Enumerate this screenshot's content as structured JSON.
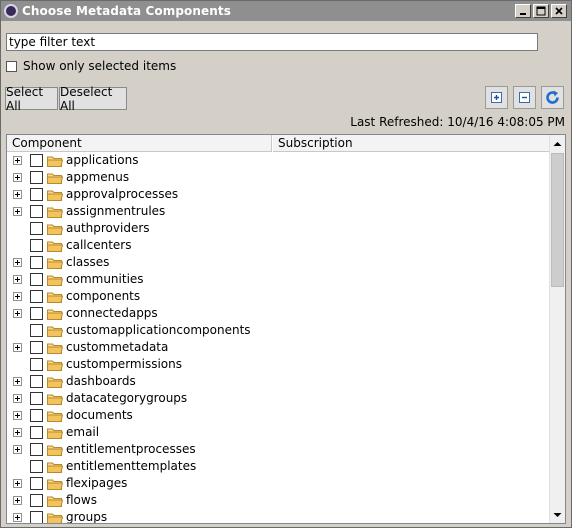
{
  "window": {
    "title": "Choose Metadata Components"
  },
  "filter": {
    "value": "type filter text"
  },
  "show_selected": {
    "label": "Show only selected items",
    "checked": false
  },
  "buttons": {
    "select_all": "Select All",
    "deselect_all": "Deselect All"
  },
  "icons": {
    "app": "app-icon",
    "minimize": "minimize-icon",
    "maximize": "maximize-icon",
    "close": "close-icon",
    "expand_all": "expand-all-icon",
    "collapse_all": "collapse-all-icon",
    "refresh": "refresh-icon",
    "folder": "folder-icon"
  },
  "last_refreshed": "Last Refreshed:  10/4/16 4:08:05 PM",
  "table": {
    "columns": [
      "Component",
      "Subscription"
    ],
    "rows": [
      {
        "label": "applications",
        "expandable": true
      },
      {
        "label": "appmenus",
        "expandable": true
      },
      {
        "label": "approvalprocesses",
        "expandable": true
      },
      {
        "label": "assignmentrules",
        "expandable": true
      },
      {
        "label": "authproviders",
        "expandable": false
      },
      {
        "label": "callcenters",
        "expandable": false
      },
      {
        "label": "classes",
        "expandable": true
      },
      {
        "label": "communities",
        "expandable": true
      },
      {
        "label": "components",
        "expandable": true
      },
      {
        "label": "connectedapps",
        "expandable": true
      },
      {
        "label": "customapplicationcomponents",
        "expandable": false
      },
      {
        "label": "custommetadata",
        "expandable": true
      },
      {
        "label": "custompermissions",
        "expandable": false
      },
      {
        "label": "dashboards",
        "expandable": true
      },
      {
        "label": "datacategorygroups",
        "expandable": true
      },
      {
        "label": "documents",
        "expandable": true
      },
      {
        "label": "email",
        "expandable": true
      },
      {
        "label": "entitlementprocesses",
        "expandable": true
      },
      {
        "label": "entitlementtemplates",
        "expandable": false
      },
      {
        "label": "flexipages",
        "expandable": true
      },
      {
        "label": "flows",
        "expandable": true
      },
      {
        "label": "groups",
        "expandable": true
      }
    ]
  },
  "colors": {
    "titlebar": "#8f8f8f",
    "accent_blue": "#1f6fd0",
    "folder": "#e8b84a"
  }
}
